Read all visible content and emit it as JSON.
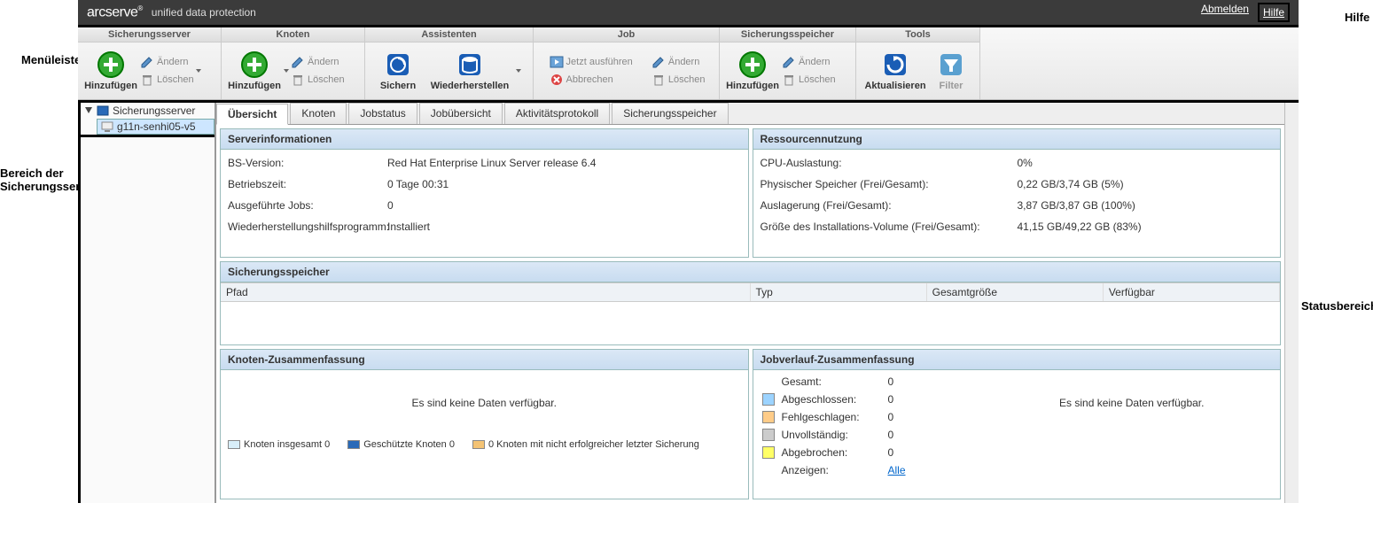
{
  "callouts": {
    "menubar": "Menüleiste",
    "nav": "Bereich der Sicherungsserver",
    "hilfe": "Hilfe",
    "status": "Statusbereich"
  },
  "header": {
    "brand": "arcserve",
    "product": "unified data protection",
    "logout": "Abmelden",
    "help": "Hilfe"
  },
  "ribbon": {
    "groups": [
      {
        "title": "Sicherungsserver",
        "add": "Hinzufügen",
        "edit": "Ändern",
        "delete": "Löschen"
      },
      {
        "title": "Knoten",
        "add": "Hinzufügen",
        "edit": "Ändern",
        "delete": "Löschen"
      },
      {
        "title": "Assistenten",
        "backup": "Sichern",
        "restore": "Wiederherstellen"
      },
      {
        "title": "Job",
        "run": "Jetzt ausführen",
        "edit": "Ändern",
        "cancel": "Abbrechen",
        "delete": "Löschen"
      },
      {
        "title": "Sicherungsspeicher",
        "add": "Hinzufügen",
        "edit": "Ändern",
        "delete": "Löschen"
      },
      {
        "title": "Tools",
        "refresh": "Aktualisieren",
        "filter": "Filter"
      }
    ]
  },
  "nav": {
    "root": "Sicherungsserver",
    "node": "g11n-senhi05-v5"
  },
  "tabs": [
    "Übersicht",
    "Knoten",
    "Jobstatus",
    "Jobübersicht",
    "Aktivitätsprotokoll",
    "Sicherungsspeicher"
  ],
  "serverinfo": {
    "title": "Serverinformationen",
    "os_label": "BS-Version:",
    "os_value": "Red Hat Enterprise Linux Server release 6.4",
    "uptime_label": "Betriebszeit:",
    "uptime_value": "0 Tage 00:31",
    "jobs_label": "Ausgeführte Jobs:",
    "jobs_value": "0",
    "restore_label": "Wiederherstellungshilfsprogramm:",
    "restore_value": "Installiert"
  },
  "resources": {
    "title": "Ressourcennutzung",
    "cpu_label": "CPU-Auslastung:",
    "cpu_value": "0%",
    "mem_label": "Physischer Speicher (Frei/Gesamt):",
    "mem_value": "0,22 GB/3,74 GB (5%)",
    "swap_label": "Auslagerung (Frei/Gesamt):",
    "swap_value": "3,87 GB/3,87 GB (100%)",
    "vol_label": "Größe des Installations-Volume (Frei/Gesamt):",
    "vol_value": "41,15 GB/49,22 GB (83%)"
  },
  "storage": {
    "title": "Sicherungsspeicher",
    "cols": {
      "path": "Pfad",
      "type": "Typ",
      "total": "Gesamtgröße",
      "avail": "Verfügbar"
    }
  },
  "nodesummary": {
    "title": "Knoten-Zusammenfassung",
    "nodata": "Es sind keine Daten verfügbar.",
    "legend": {
      "total": "Knoten insgesamt 0",
      "protected": "Geschützte Knoten 0",
      "failed": "0 Knoten mit nicht erfolgreicher letzter Sicherung"
    }
  },
  "jobhist": {
    "title": "Jobverlauf-Zusammenfassung",
    "rows": {
      "total_label": "Gesamt:",
      "total_value": "0",
      "done_label": "Abgeschlossen:",
      "done_value": "0",
      "failed_label": "Fehlgeschlagen:",
      "failed_value": "0",
      "incomplete_label": "Unvollständig:",
      "incomplete_value": "0",
      "cancelled_label": "Abgebrochen:",
      "cancelled_value": "0",
      "show_label": "Anzeigen:",
      "show_value": "Alle"
    },
    "nodata": "Es sind keine Daten verfügbar.",
    "colors": {
      "done": "#9cd3ff",
      "failed": "#ffcc88",
      "incomplete": "#cccccc",
      "cancelled": "#ffff66"
    }
  }
}
